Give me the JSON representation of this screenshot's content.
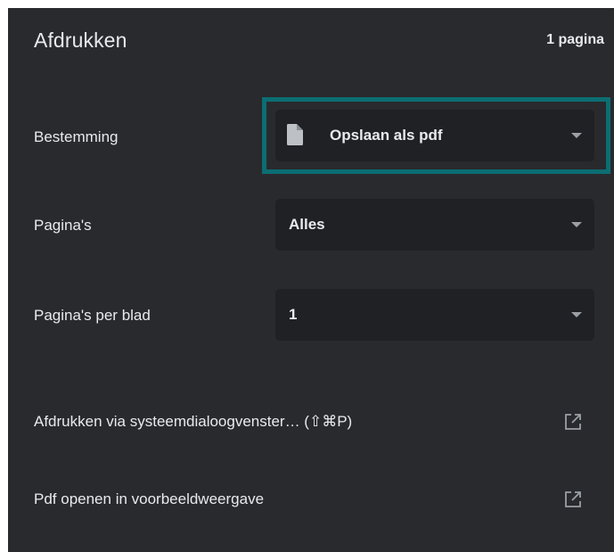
{
  "header": {
    "title": "Afdrukken",
    "page_count": "1 pagina"
  },
  "destination": {
    "label": "Bestemming",
    "value": "Opslaan als pdf",
    "icon": "document-icon"
  },
  "pages": {
    "label": "Pagina's",
    "value": "Alles"
  },
  "pages_per_sheet": {
    "label": "Pagina's per blad",
    "value": "1"
  },
  "links": [
    {
      "label": "Afdrukken via systeemdialoogvenster… (⇧⌘P)",
      "icon": "open-external-icon"
    },
    {
      "label": "Pdf openen in voorbeeldweergave",
      "icon": "open-external-icon"
    }
  ],
  "colors": {
    "panel_bg": "#292a2d",
    "select_bg": "#202124",
    "text": "#e8eaed",
    "muted": "#9aa0a6",
    "focus_ring": "#0b6e73"
  }
}
